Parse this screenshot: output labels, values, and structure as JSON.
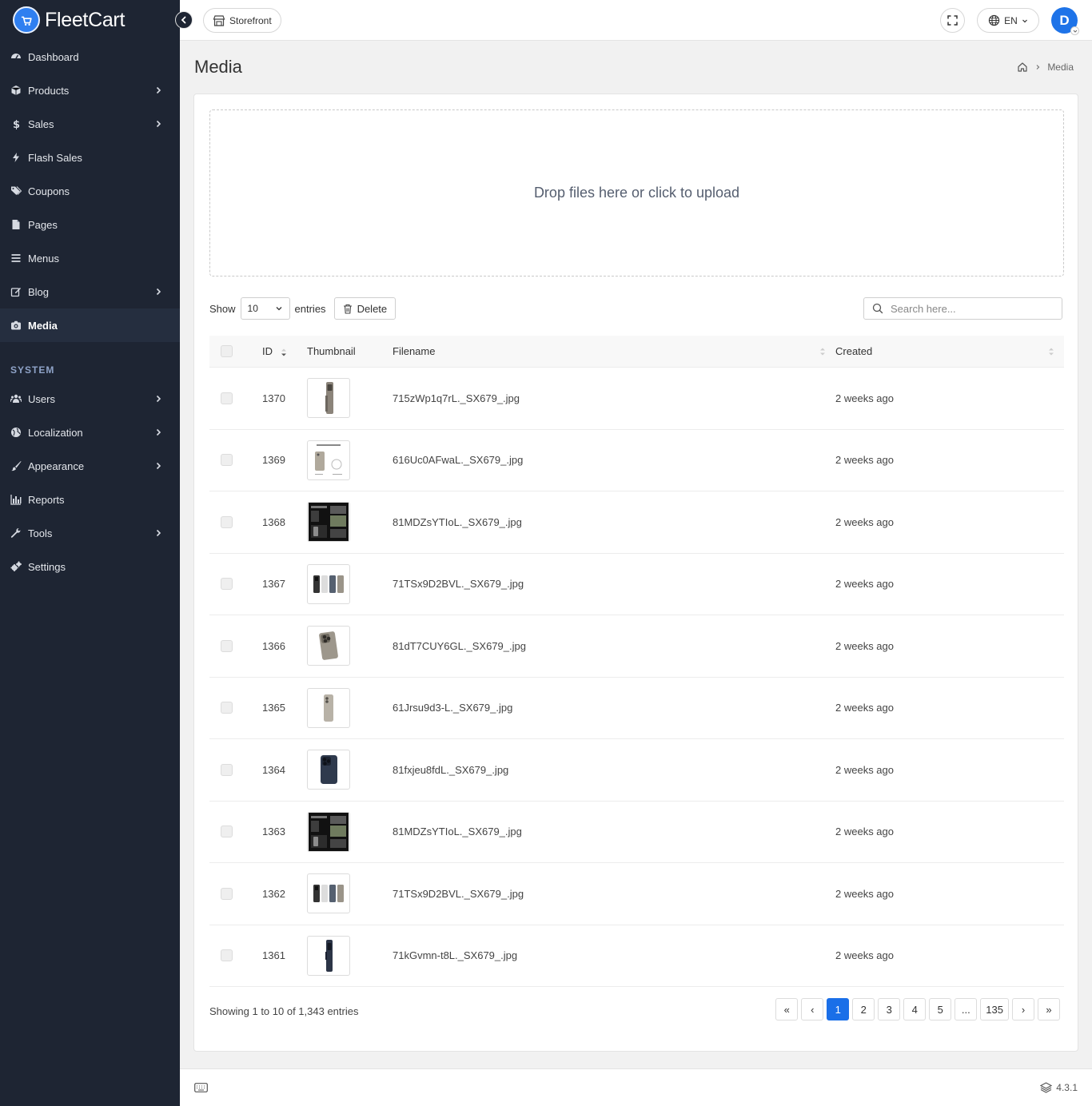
{
  "app": {
    "name": "FleetCart",
    "version": "4.3.1"
  },
  "sidebar": {
    "items": [
      {
        "key": "dashboard",
        "label": "Dashboard",
        "icon": "dashboard-icon",
        "chevron": false
      },
      {
        "key": "products",
        "label": "Products",
        "icon": "cube-icon",
        "chevron": true
      },
      {
        "key": "sales",
        "label": "Sales",
        "icon": "dollar-icon",
        "chevron": true
      },
      {
        "key": "flash-sales",
        "label": "Flash Sales",
        "icon": "bolt-icon",
        "chevron": false
      },
      {
        "key": "coupons",
        "label": "Coupons",
        "icon": "tags-icon",
        "chevron": false
      },
      {
        "key": "pages",
        "label": "Pages",
        "icon": "file-icon",
        "chevron": false
      },
      {
        "key": "menus",
        "label": "Menus",
        "icon": "bars-icon",
        "chevron": false
      },
      {
        "key": "blog",
        "label": "Blog",
        "icon": "edit-icon",
        "chevron": true
      },
      {
        "key": "media",
        "label": "Media",
        "icon": "camera-icon",
        "chevron": false,
        "active": true
      }
    ],
    "system_title": "SYSTEM",
    "system_items": [
      {
        "key": "users",
        "label": "Users",
        "icon": "users-icon",
        "chevron": true
      },
      {
        "key": "localization",
        "label": "Localization",
        "icon": "globe-icon",
        "chevron": true
      },
      {
        "key": "appearance",
        "label": "Appearance",
        "icon": "brush-icon",
        "chevron": true
      },
      {
        "key": "reports",
        "label": "Reports",
        "icon": "bar-chart-icon",
        "chevron": false
      },
      {
        "key": "tools",
        "label": "Tools",
        "icon": "wrench-icon",
        "chevron": true
      },
      {
        "key": "settings",
        "label": "Settings",
        "icon": "cogs-icon",
        "chevron": false
      }
    ]
  },
  "topbar": {
    "storefront_label": "Storefront",
    "language": "EN",
    "avatar_initial": "D"
  },
  "page": {
    "title": "Media",
    "breadcrumb_current": "Media"
  },
  "upload": {
    "prompt": "Drop files here or click to upload"
  },
  "toolbar": {
    "show_label": "Show",
    "entries_value": "10",
    "entries_label": "entries",
    "delete_label": "Delete",
    "search_placeholder": "Search here..."
  },
  "table": {
    "headers": {
      "id": "ID",
      "thumbnail": "Thumbnail",
      "filename": "Filename",
      "created": "Created"
    },
    "rows": [
      {
        "id": "1370",
        "thumb": "phone-single",
        "filename": "715zWp1q7rL._SX679_.jpg",
        "created": "2 weeks ago"
      },
      {
        "id": "1369",
        "thumb": "box-contents",
        "filename": "616Uc0AFwaL._SX679_.jpg",
        "created": "2 weeks ago"
      },
      {
        "id": "1368",
        "thumb": "dark-collage",
        "filename": "81MDZsYTIoL._SX679_.jpg",
        "created": "2 weeks ago"
      },
      {
        "id": "1367",
        "thumb": "phone-group",
        "filename": "71TSx9D2BVL._SX679_.jpg",
        "created": "2 weeks ago"
      },
      {
        "id": "1366",
        "thumb": "phone-camera",
        "filename": "81dT7CUY6GL._SX679_.jpg",
        "created": "2 weeks ago"
      },
      {
        "id": "1365",
        "thumb": "phone-single-light",
        "filename": "61Jrsu9d3-L._SX679_.jpg",
        "created": "2 weeks ago"
      },
      {
        "id": "1364",
        "thumb": "phone-blue",
        "filename": "81fxjeu8fdL._SX679_.jpg",
        "created": "2 weeks ago"
      },
      {
        "id": "1363",
        "thumb": "dark-collage",
        "filename": "81MDZsYTIoL._SX679_.jpg",
        "created": "2 weeks ago"
      },
      {
        "id": "1362",
        "thumb": "phone-group",
        "filename": "71TSx9D2BVL._SX679_.jpg",
        "created": "2 weeks ago"
      },
      {
        "id": "1361",
        "thumb": "phone-side-blue",
        "filename": "71kGvmn-t8L._SX679_.jpg",
        "created": "2 weeks ago"
      }
    ]
  },
  "pagination": {
    "info": "Showing 1 to 10 of 1,343 entries",
    "first": "«",
    "prev": "‹",
    "next": "›",
    "last": "»",
    "pages": [
      "1",
      "2",
      "3",
      "4",
      "5",
      "...",
      "135"
    ],
    "active": "1"
  },
  "colors": {
    "sidebar_bg": "#1e2533",
    "accent": "#1a6fe8",
    "page_bg": "#f1f1f1"
  }
}
